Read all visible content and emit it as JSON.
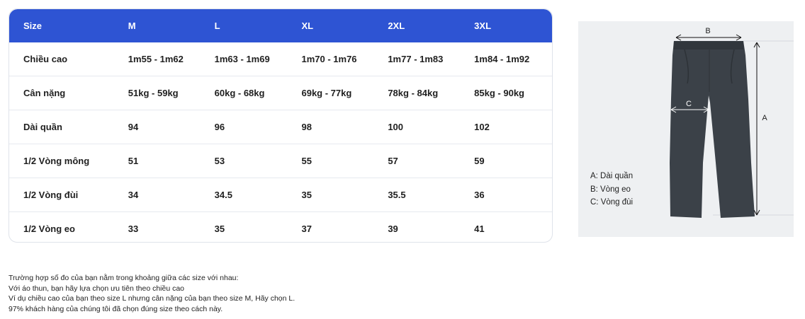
{
  "table": {
    "header": [
      "Size",
      "M",
      "L",
      "XL",
      "2XL",
      "3XL"
    ],
    "rows": [
      [
        "Chiều cao",
        "1m55 - 1m62",
        "1m63 - 1m69",
        "1m70 - 1m76",
        "1m77 - 1m83",
        "1m84 - 1m92"
      ],
      [
        "Cân nặng",
        "51kg - 59kg",
        "60kg - 68kg",
        "69kg - 77kg",
        "78kg - 84kg",
        "85kg - 90kg"
      ],
      [
        "Dài quần",
        "94",
        "96",
        "98",
        "100",
        "102"
      ],
      [
        "1/2 Vòng mông",
        "51",
        "53",
        "55",
        "57",
        "59"
      ],
      [
        "1/2 Vòng đùi",
        "34",
        "34.5",
        "35",
        "35.5",
        "36"
      ],
      [
        "1/2 Vòng eo",
        "33",
        "35",
        "37",
        "39",
        "41"
      ]
    ]
  },
  "diagram": {
    "label_a": "A",
    "label_b": "B",
    "label_c": "C",
    "legend": [
      "A: Dài quần",
      "B: Vòng eo",
      "C: Vòng đùi"
    ]
  },
  "notes": [
    "Trường hợp số đo của bạn nằm trong khoảng giữa các size với nhau:",
    "Với áo thun, bạn hãy lựa chọn ưu tiên theo chiều cao",
    "Ví dụ chiều cao của bạn theo size L nhưng cân nặng của bạn theo size M, Hãy chọn L.",
    "97% khách hàng của chúng tôi đã chọn đúng size theo cách này."
  ],
  "colors": {
    "header_bg": "#2e54d3",
    "pants": "#3b4148",
    "panel_bg": "#eef0f2"
  }
}
